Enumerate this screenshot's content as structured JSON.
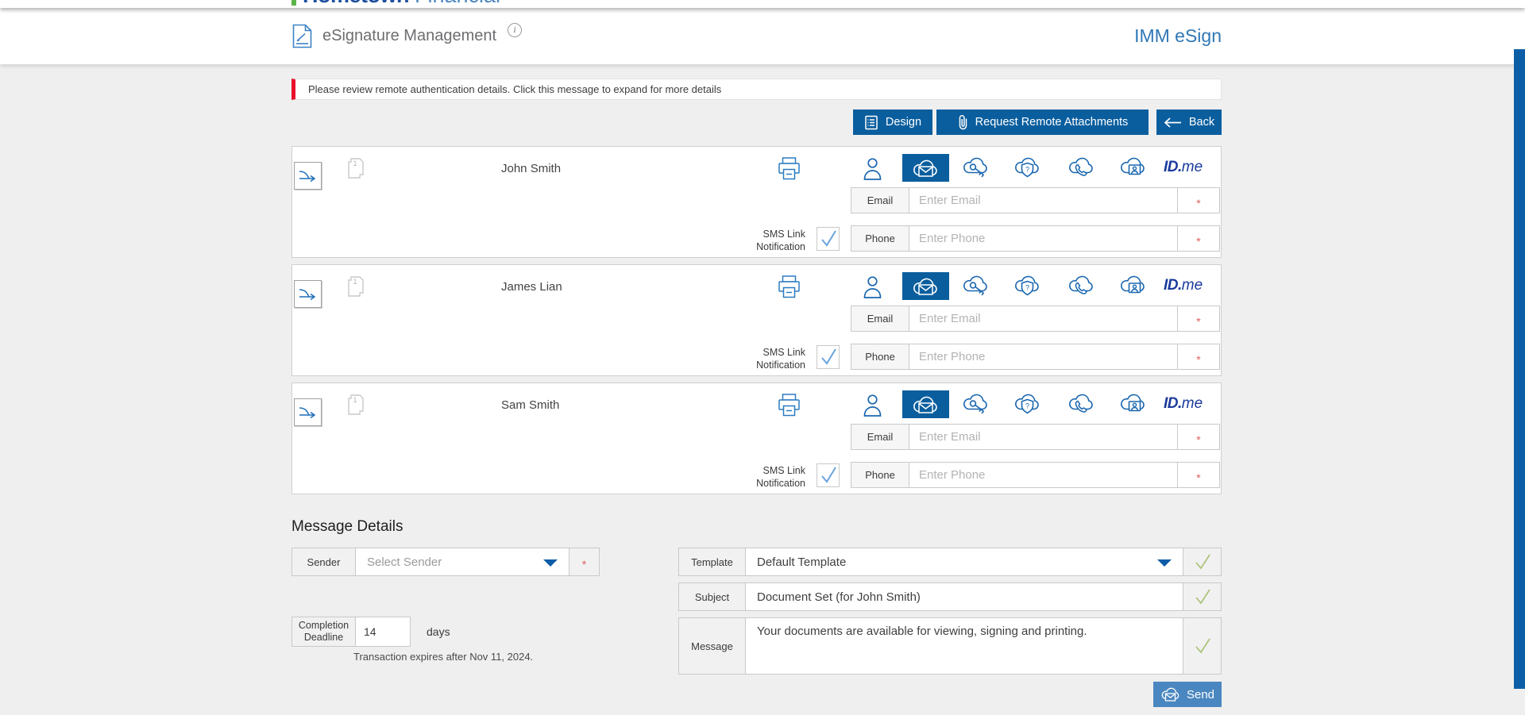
{
  "header": {
    "logo_bold": "Hometown",
    "logo_light": "Financial",
    "page_title": "eSignature Management",
    "info_glyph": "i",
    "brand": "IMM eSign"
  },
  "notification": "Please review remote authentication details. Click this message to expand for more details",
  "toolbar": {
    "design": "Design",
    "request_remote_attachments": "Request Remote Attachments",
    "back": "Back"
  },
  "recipients": [
    {
      "name": "John Smith"
    },
    {
      "name": "James Lian"
    },
    {
      "name": "Sam Smith"
    }
  ],
  "recipient_row": {
    "doc_count": "1",
    "shield_glyph": "?",
    "sms_label_line1": "SMS Link",
    "sms_label_line2": "Notification",
    "email_label": "Email",
    "email_placeholder": "Enter Email",
    "phone_label": "Phone",
    "phone_placeholder": "Enter Phone",
    "required_marker": "*",
    "idme_bold": "ID.",
    "idme_italic": "me"
  },
  "message_details": {
    "heading": "Message Details",
    "sender_label": "Sender",
    "sender_value": "Select Sender",
    "required_marker": "*",
    "deadline_label_line1": "Completion",
    "deadline_label_line2": "Deadline",
    "deadline_value": "14",
    "deadline_unit": "days",
    "expiry_note": "Transaction expires after Nov 11, 2024.",
    "template_label": "Template",
    "template_value": "Default Template",
    "subject_label": "Subject",
    "subject_value": "Document Set (for John Smith)",
    "message_label": "Message",
    "message_value": "Your documents are available for viewing, signing and printing.",
    "send": "Send"
  },
  "colors": {
    "primary_blue": "#0a5e9e",
    "send_blue": "#4a87c0",
    "icon_blue": "#1f6fb8",
    "brand_blue": "#3077b5",
    "alert_red": "#e8112d",
    "required_red": "#e25d5d",
    "success_green": "#a9c276",
    "logo_green": "#5cb449",
    "page_bg": "#efefef"
  }
}
